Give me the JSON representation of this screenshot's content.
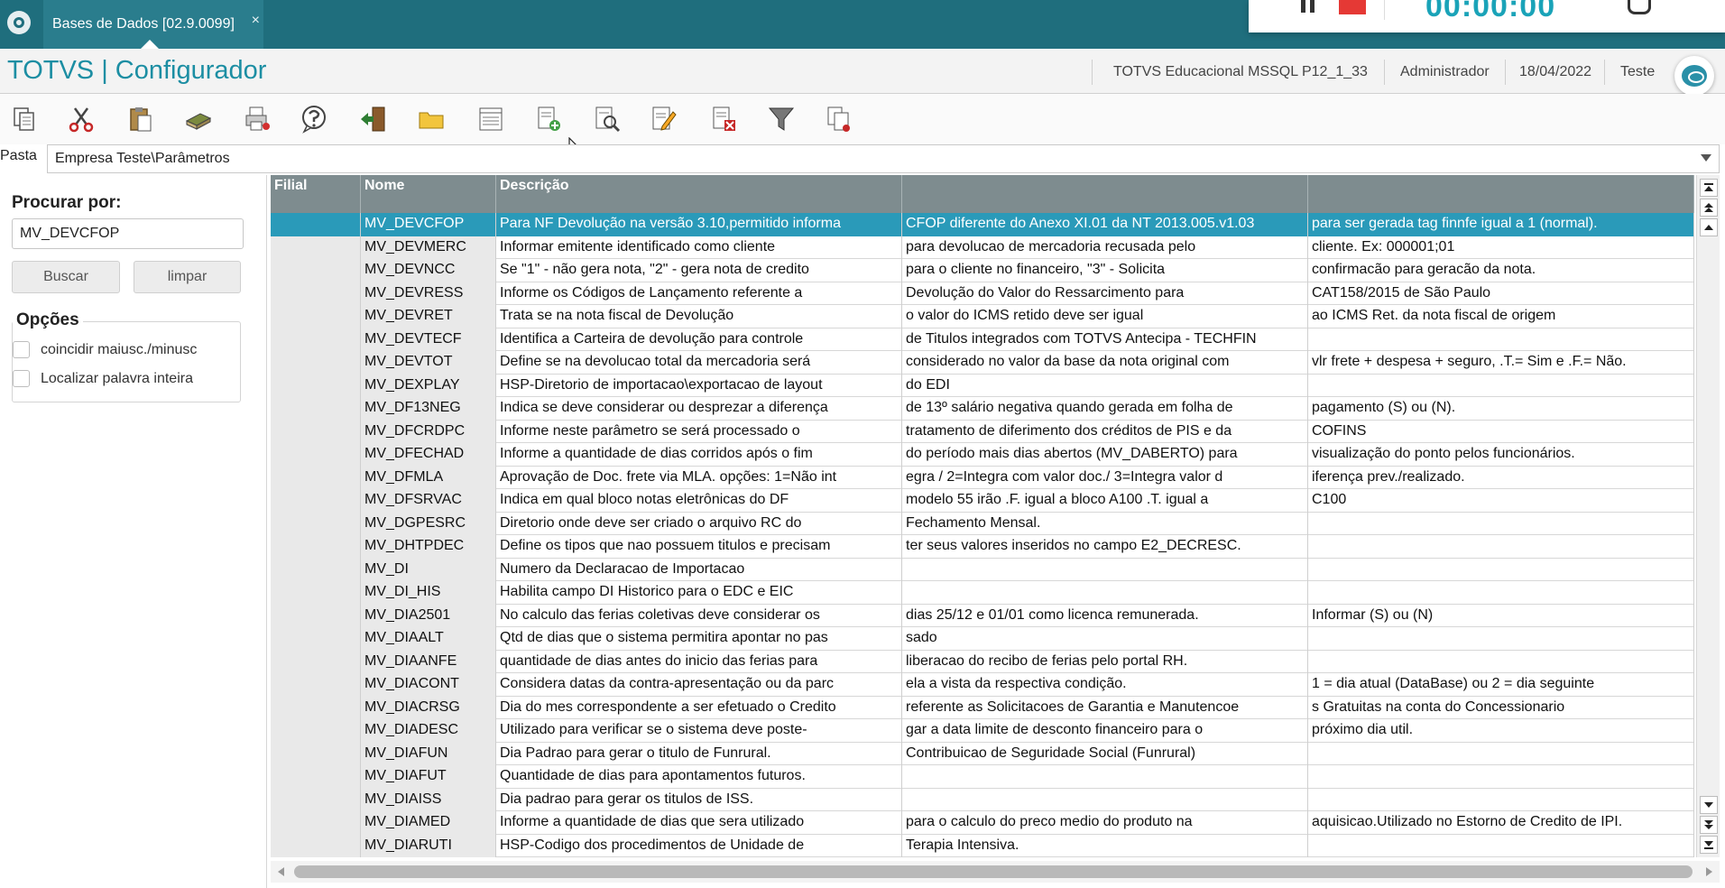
{
  "tab": {
    "title": "Bases de Dados [02.9.0099]",
    "close": "×"
  },
  "timer": {
    "time": "00:00:00"
  },
  "header": {
    "brand": "TOTVS | Configurador",
    "environment": "TOTVS Educacional MSSQL P12_1_33",
    "user": "Administrador",
    "date": "18/04/2022",
    "company": "Teste"
  },
  "toolbar": {
    "icons": [
      "copy-icon",
      "cut-icon",
      "paste-icon",
      "book-icon",
      "print-icon",
      "help-icon",
      "exit-icon",
      "folder-icon",
      "list-icon",
      "add-record-icon",
      "search-record-icon",
      "edit-record-icon",
      "delete-record-icon",
      "filter-icon",
      "copy-record-icon"
    ]
  },
  "pasta": {
    "label": "Pasta",
    "value": "Empresa Teste\\Parâmetros"
  },
  "search": {
    "title": "Procurar por:",
    "value": "MV_DEVCFOP",
    "buscar": "Buscar",
    "limpar": "limpar"
  },
  "options": {
    "title": "Opções",
    "case": "coincidir maiusc./minusc",
    "whole": "Localizar palavra inteira"
  },
  "grid": {
    "columns": [
      "Filial",
      "Nome",
      "Descrição",
      "",
      ""
    ],
    "rows": [
      [
        "",
        "MV_DEVCFOP",
        "Para NF Devolução na versão 3.10,permitido informa",
        "CFOP diferente do Anexo XI.01 da NT 2013.005.v1.03",
        "para ser gerada tag finnfe igual a 1 (normal)."
      ],
      [
        "",
        "MV_DEVMERC",
        "Informar emitente identificado como cliente",
        "para devolucao de mercadoria recusada pelo",
        "cliente.  Ex: 000001;01"
      ],
      [
        "",
        "MV_DEVNCC",
        "Se \"1\" - não gera nota, \"2\" - gera nota de credito",
        " para o cliente no financeiro, \"3\" - Solicita",
        "confirmacão para geracão da nota."
      ],
      [
        "",
        "MV_DEVRESS",
        "Informe os Códigos de Lançamento referente a",
        "Devolução do Valor do Ressarcimento para",
        "CAT158/2015 de São Paulo"
      ],
      [
        "",
        "MV_DEVRET",
        "Trata se na nota fiscal de Devolução",
        "o valor do ICMS retido deve ser igual",
        "ao ICMS Ret. da nota fiscal de origem"
      ],
      [
        "",
        "MV_DEVTECF",
        "Identifica a Carteira de devolução para controle",
        "de Titulos integrados com TOTVS Antecipa - TECHFIN",
        ""
      ],
      [
        "",
        "MV_DEVTOT",
        "Define se na devolucao total da mercadoria será",
        "considerado no valor da base da nota original com",
        "vlr frete + despesa + seguro, .T.= Sim e .F.= Não."
      ],
      [
        "",
        "MV_DEXPLAY",
        "HSP-Diretorio de importacao\\exportacao de layout",
        "do EDI",
        ""
      ],
      [
        "",
        "MV_DF13NEG",
        "Indica se deve considerar ou desprezar a diferença",
        "de 13º salário negativa quando gerada em folha de",
        "pagamento (S) ou (N)."
      ],
      [
        "",
        "MV_DFCRDPC",
        "Informe neste parâmetro se será processado o",
        "tratamento de diferimento dos créditos de PIS e da",
        "COFINS"
      ],
      [
        "",
        "MV_DFECHAD",
        "Informe a quantidade de dias corridos após o fim",
        "do período mais dias abertos (MV_DABERTO) para",
        "visualização do ponto pelos funcionários."
      ],
      [
        "",
        "MV_DFMLA",
        "Aprovação de Doc. frete via MLA. opções: 1=Não int",
        "egra / 2=Integra com valor doc./ 3=Integra valor d",
        "iferença prev./realizado."
      ],
      [
        "",
        "MV_DFSRVAC",
        "Indica em qual bloco notas eletrônicas do DF",
        "modelo 55 irão .F. igual a bloco A100 .T. igual a",
        "C100"
      ],
      [
        "",
        "MV_DGPESRC",
        "Diretorio onde deve ser criado o arquivo RC do",
        "Fechamento Mensal.",
        ""
      ],
      [
        "",
        "MV_DHTPDEC",
        "Define os tipos que nao possuem titulos e precisam",
        "ter seus valores inseridos no campo E2_DECRESC.",
        ""
      ],
      [
        "",
        "MV_DI",
        "Numero da Declaracao de Importacao",
        "",
        ""
      ],
      [
        "",
        "MV_DI_HIS",
        "Habilita campo DI Historico para o EDC e EIC",
        "",
        ""
      ],
      [
        "",
        "MV_DIA2501",
        "No calculo das ferias coletivas deve considerar os",
        "dias 25/12 e 01/01 como licenca remunerada.",
        "Informar (S) ou (N)"
      ],
      [
        "",
        "MV_DIAALT",
        "Qtd de dias que o sistema permitira apontar no pas",
        "sado",
        ""
      ],
      [
        "",
        "MV_DIAANFE",
        "quantidade de dias antes do inicio das ferias para",
        "liberacao do recibo de ferias pelo portal RH.",
        ""
      ],
      [
        "",
        "MV_DIACONT",
        "Considera datas da contra-apresentação ou da parc",
        "ela a vista da respectiva condição.",
        "1 = dia atual (DataBase) ou 2 = dia seguinte"
      ],
      [
        "",
        "MV_DIACRSG",
        "Dia do mes correspondente a ser efetuado o Credito",
        "referente as Solicitacoes de Garantia e Manutencoe",
        "s Gratuitas na conta do Concessionario"
      ],
      [
        "",
        "MV_DIADESC",
        "Utilizado para verificar se o sistema deve  poste-",
        "gar a data limite de desconto financeiro para o",
        "próximo dia util."
      ],
      [
        "",
        "MV_DIAFUN",
        "Dia Padrao para gerar o titulo de Funrural.",
        "Contribuicao de Seguridade Social (Funrural)",
        ""
      ],
      [
        "",
        "MV_DIAFUT",
        "Quantidade de dias para apontamentos futuros.",
        "",
        ""
      ],
      [
        "",
        "MV_DIAISS",
        "Dia padrao para gerar os titulos de  ISS.",
        "",
        ""
      ],
      [
        "",
        "MV_DIAMED",
        "Informe a quantidade de dias que sera utilizado",
        "para o calculo do preco medio do produto na",
        "aquisicao.Utilizado no Estorno de Credito de IPI."
      ],
      [
        "",
        "MV_DIARUTI",
        "HSP-Codigo dos procedimentos de Unidade de",
        "Terapia Intensiva.",
        ""
      ]
    ]
  }
}
